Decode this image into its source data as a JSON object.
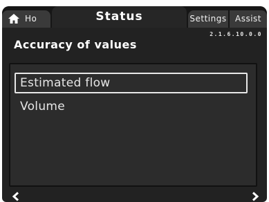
{
  "tabs": {
    "home_label": "Ho",
    "status_label": "Status",
    "settings_label": "Settings",
    "assist_label": "Assist"
  },
  "header": {
    "menu_id": "2.1.6.10.0.0",
    "title": "Accuracy of values"
  },
  "list": {
    "items": [
      {
        "label": "Estimated flow",
        "selected": true
      },
      {
        "label": "Volume",
        "selected": false
      }
    ]
  },
  "icons": {
    "home": "home-icon",
    "prev": "chevron-left-icon",
    "next": "chevron-right-icon"
  },
  "colors": {
    "background": "#222222",
    "tab_bar": "#161616",
    "inactive_tab": "#3a3a3a",
    "text": "#ffffff",
    "selection_border": "#e8e8e8"
  }
}
